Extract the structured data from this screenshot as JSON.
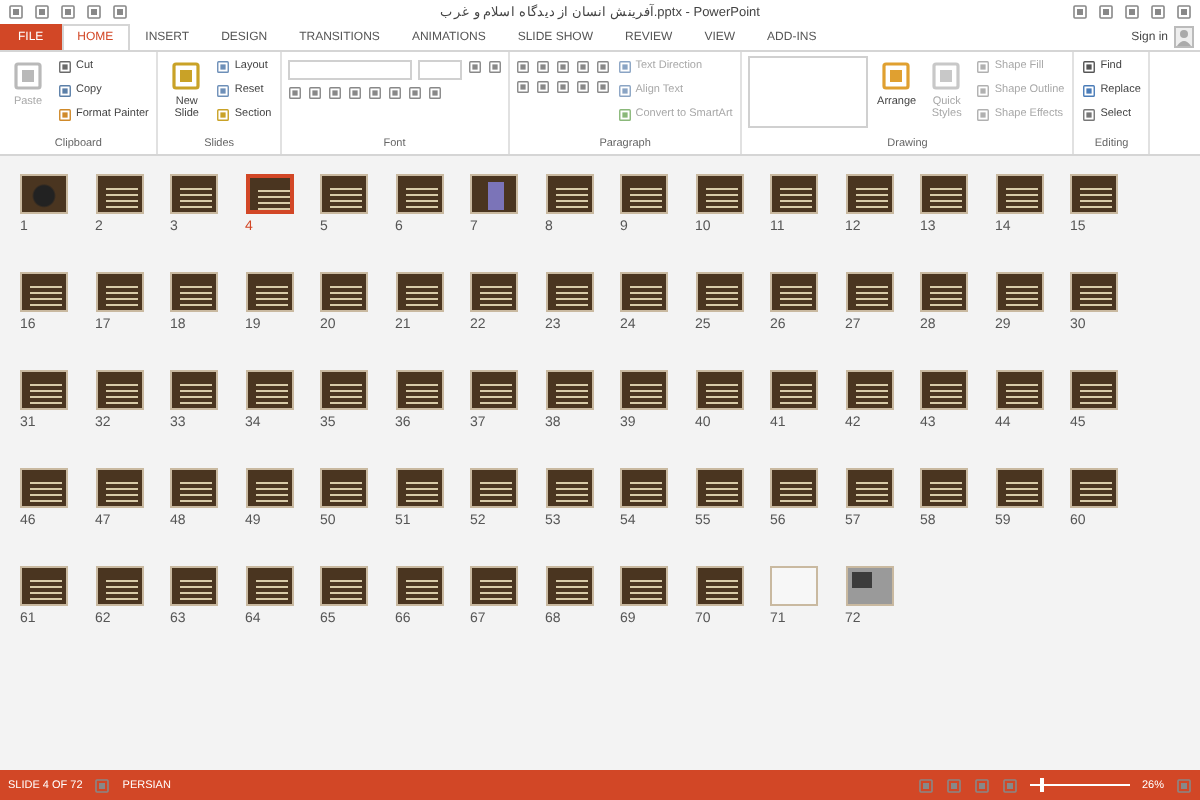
{
  "window": {
    "title": "آفرینش انسان از دیدگاه اسلام و غرب.pptx - PowerPoint",
    "sign_in": "Sign in"
  },
  "tabs": [
    {
      "label": "FILE",
      "kind": "file",
      "selected": false
    },
    {
      "label": "HOME",
      "kind": "tab",
      "selected": true
    },
    {
      "label": "INSERT",
      "kind": "tab",
      "selected": false
    },
    {
      "label": "DESIGN",
      "kind": "tab",
      "selected": false
    },
    {
      "label": "TRANSITIONS",
      "kind": "tab",
      "selected": false
    },
    {
      "label": "ANIMATIONS",
      "kind": "tab",
      "selected": false
    },
    {
      "label": "SLIDE SHOW",
      "kind": "tab",
      "selected": false
    },
    {
      "label": "REVIEW",
      "kind": "tab",
      "selected": false
    },
    {
      "label": "VIEW",
      "kind": "tab",
      "selected": false
    },
    {
      "label": "ADD-INS",
      "kind": "tab",
      "selected": false
    }
  ],
  "ribbon": [
    {
      "label": "Clipboard",
      "items": [
        {
          "kind": "large",
          "label": "Paste",
          "disabled": true
        },
        {
          "kind": "small",
          "label": "Cut",
          "disabled": false
        },
        {
          "kind": "small",
          "label": "Copy",
          "disabled": false
        },
        {
          "kind": "small",
          "label": "Format Painter",
          "disabled": false
        }
      ]
    },
    {
      "label": "Slides",
      "items": [
        {
          "kind": "large",
          "label": "New Slide",
          "disabled": false
        },
        {
          "kind": "small",
          "label": "Layout",
          "disabled": false
        },
        {
          "kind": "small",
          "label": "Reset",
          "disabled": false
        },
        {
          "kind": "small",
          "label": "Section",
          "disabled": false
        }
      ]
    },
    {
      "label": "Font",
      "items": [
        {
          "kind": "font-controls"
        }
      ]
    },
    {
      "label": "Paragraph",
      "items": [
        {
          "kind": "paragraph-controls"
        },
        {
          "kind": "small",
          "label": "Text Direction",
          "disabled": true
        },
        {
          "kind": "small",
          "label": "Align Text",
          "disabled": true
        },
        {
          "kind": "small",
          "label": "Convert to SmartArt",
          "disabled": true
        }
      ]
    },
    {
      "label": "Drawing",
      "items": [
        {
          "kind": "shapes-gallery"
        },
        {
          "kind": "large",
          "label": "Arrange",
          "disabled": false
        },
        {
          "kind": "large",
          "label": "Quick Styles",
          "disabled": true
        },
        {
          "kind": "small",
          "label": "Shape Fill",
          "disabled": true
        },
        {
          "kind": "small",
          "label": "Shape Outline",
          "disabled": true
        },
        {
          "kind": "small",
          "label": "Shape Effects",
          "disabled": true
        }
      ]
    },
    {
      "label": "Editing",
      "items": [
        {
          "kind": "small",
          "label": "Find",
          "disabled": false
        },
        {
          "kind": "small",
          "label": "Replace",
          "disabled": false
        },
        {
          "kind": "small",
          "label": "Select",
          "disabled": false
        }
      ]
    }
  ],
  "slides": [
    {
      "number": "1",
      "kind": "dark",
      "selected": false
    },
    {
      "number": "2",
      "kind": "text",
      "selected": false
    },
    {
      "number": "3",
      "kind": "text",
      "selected": false
    },
    {
      "number": "4",
      "kind": "text",
      "selected": true
    },
    {
      "number": "5",
      "kind": "text",
      "selected": false
    },
    {
      "number": "6",
      "kind": "text",
      "selected": false
    },
    {
      "number": "7",
      "kind": "figure",
      "selected": false
    },
    {
      "number": "8",
      "kind": "text",
      "selected": false
    },
    {
      "number": "9",
      "kind": "text",
      "selected": false
    },
    {
      "number": "10",
      "kind": "text",
      "selected": false
    },
    {
      "number": "11",
      "kind": "text",
      "selected": false
    },
    {
      "number": "12",
      "kind": "text",
      "selected": false
    },
    {
      "number": "13",
      "kind": "text",
      "selected": false
    },
    {
      "number": "14",
      "kind": "text",
      "selected": false
    },
    {
      "number": "15",
      "kind": "text",
      "selected": false
    },
    {
      "number": "16",
      "kind": "text",
      "selected": false
    },
    {
      "number": "17",
      "kind": "text",
      "selected": false
    },
    {
      "number": "18",
      "kind": "text",
      "selected": false
    },
    {
      "number": "19",
      "kind": "text",
      "selected": false
    },
    {
      "number": "20",
      "kind": "text",
      "selected": false
    },
    {
      "number": "21",
      "kind": "text",
      "selected": false
    },
    {
      "number": "22",
      "kind": "text",
      "selected": false
    },
    {
      "number": "23",
      "kind": "text",
      "selected": false
    },
    {
      "number": "24",
      "kind": "text",
      "selected": false
    },
    {
      "number": "25",
      "kind": "text",
      "selected": false
    },
    {
      "number": "26",
      "kind": "text",
      "selected": false
    },
    {
      "number": "27",
      "kind": "text",
      "selected": false
    },
    {
      "number": "28",
      "kind": "text",
      "selected": false
    },
    {
      "number": "29",
      "kind": "text",
      "selected": false
    },
    {
      "number": "30",
      "kind": "text",
      "selected": false
    },
    {
      "number": "31",
      "kind": "text",
      "selected": false
    },
    {
      "number": "32",
      "kind": "text",
      "selected": false
    },
    {
      "number": "33",
      "kind": "text",
      "selected": false
    },
    {
      "number": "34",
      "kind": "text",
      "selected": false
    },
    {
      "number": "35",
      "kind": "text",
      "selected": false
    },
    {
      "number": "36",
      "kind": "text",
      "selected": false
    },
    {
      "number": "37",
      "kind": "text",
      "selected": false
    },
    {
      "number": "38",
      "kind": "text",
      "selected": false
    },
    {
      "number": "39",
      "kind": "text",
      "selected": false
    },
    {
      "number": "40",
      "kind": "text",
      "selected": false
    },
    {
      "number": "41",
      "kind": "text",
      "selected": false
    },
    {
      "number": "42",
      "kind": "text",
      "selected": false
    },
    {
      "number": "43",
      "kind": "text",
      "selected": false
    },
    {
      "number": "44",
      "kind": "text",
      "selected": false
    },
    {
      "number": "45",
      "kind": "text",
      "selected": false
    },
    {
      "number": "46",
      "kind": "text",
      "selected": false
    },
    {
      "number": "47",
      "kind": "text",
      "selected": false
    },
    {
      "number": "48",
      "kind": "text",
      "selected": false
    },
    {
      "number": "49",
      "kind": "text",
      "selected": false
    },
    {
      "number": "50",
      "kind": "text",
      "selected": false
    },
    {
      "number": "51",
      "kind": "text",
      "selected": false
    },
    {
      "number": "52",
      "kind": "text",
      "selected": false
    },
    {
      "number": "53",
      "kind": "text",
      "selected": false
    },
    {
      "number": "54",
      "kind": "text",
      "selected": false
    },
    {
      "number": "55",
      "kind": "text",
      "selected": false
    },
    {
      "number": "56",
      "kind": "text",
      "selected": false
    },
    {
      "number": "57",
      "kind": "text",
      "selected": false
    },
    {
      "number": "58",
      "kind": "text",
      "selected": false
    },
    {
      "number": "59",
      "kind": "text",
      "selected": false
    },
    {
      "number": "60",
      "kind": "text",
      "selected": false
    },
    {
      "number": "61",
      "kind": "text",
      "selected": false
    },
    {
      "number": "62",
      "kind": "text",
      "selected": false
    },
    {
      "number": "63",
      "kind": "text",
      "selected": false
    },
    {
      "number": "64",
      "kind": "text",
      "selected": false
    },
    {
      "number": "65",
      "kind": "text",
      "selected": false
    },
    {
      "number": "66",
      "kind": "text",
      "selected": false
    },
    {
      "number": "67",
      "kind": "text",
      "selected": false
    },
    {
      "number": "68",
      "kind": "text",
      "selected": false
    },
    {
      "number": "69",
      "kind": "text",
      "selected": false
    },
    {
      "number": "70",
      "kind": "text",
      "selected": false
    },
    {
      "number": "71",
      "kind": "light",
      "selected": false
    },
    {
      "number": "72",
      "kind": "photo",
      "selected": false
    }
  ],
  "status_bar": {
    "slide_info": "SLIDE 4 OF 72",
    "language": "PERSIAN",
    "zoom": {
      "level": 0.1,
      "reading": "26%"
    }
  }
}
